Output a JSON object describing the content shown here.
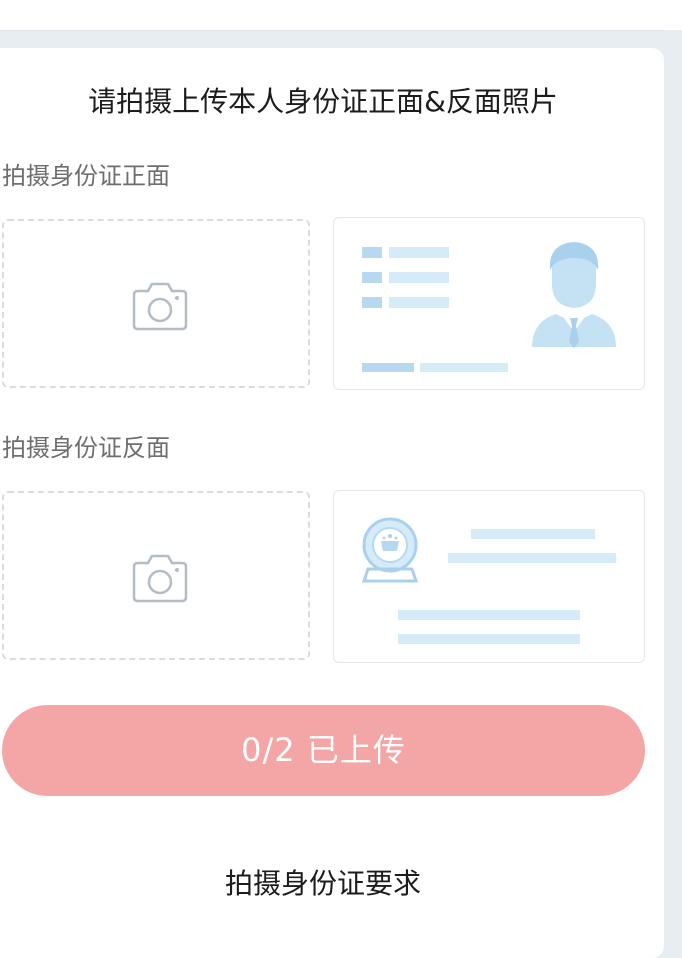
{
  "title": "请拍摄上传本人身份证正面&反面照片",
  "front": {
    "label": "拍摄身份证正面",
    "upload_icon": "camera-icon",
    "sample_icon": "id-card-front-sample"
  },
  "back": {
    "label": "拍摄身份证反面",
    "upload_icon": "camera-icon",
    "sample_icon": "id-card-back-sample"
  },
  "submit_button": {
    "label": "0/2 已上传",
    "color": "#f4a5a5"
  },
  "requirements": {
    "title": "拍摄身份证要求"
  },
  "colors": {
    "sample_accent": "#b7d9f0",
    "sample_light": "#d6ebf8",
    "camera_stroke": "#b4bcc6"
  }
}
